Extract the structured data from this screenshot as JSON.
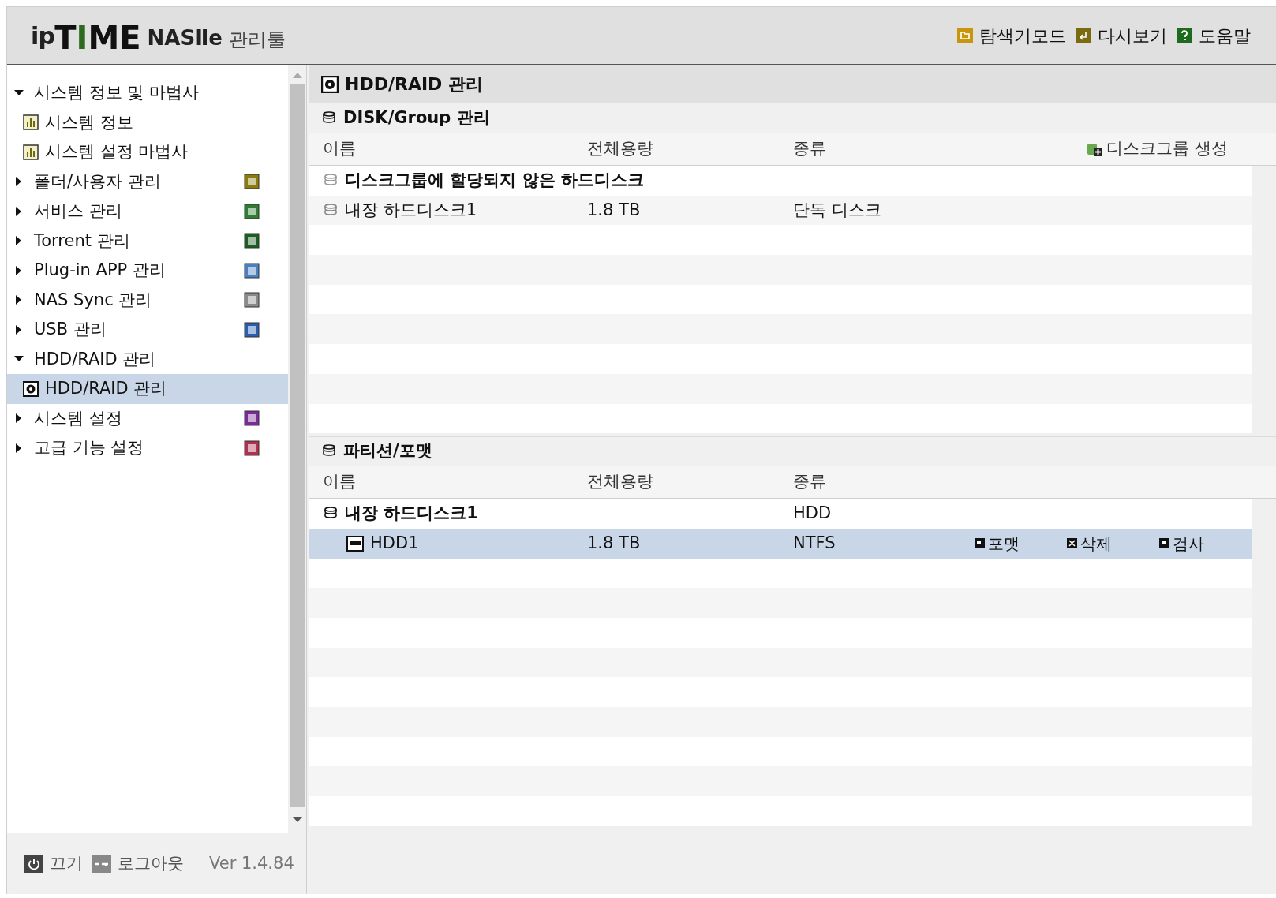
{
  "header": {
    "logo": [
      {
        "kind": "plain",
        "text": "ip"
      },
      {
        "kind": "bold",
        "text": "T"
      },
      {
        "kind": "accent",
        "text": "I"
      },
      {
        "kind": "bold",
        "text": "ME"
      },
      {
        "kind": "product",
        "text": "NASⅡe"
      },
      {
        "kind": "suffix",
        "text": "관리툴"
      }
    ],
    "links": [
      {
        "label": "탐색기모드",
        "color": "#c8960c",
        "kind": "folder"
      },
      {
        "label": "다시보기",
        "color": "#7a6a10",
        "kind": "return"
      },
      {
        "label": "도움말",
        "color": "#1e6a1e",
        "kind": "help"
      }
    ]
  },
  "sidebar": {
    "items": [
      {
        "label": "시스템 정보 및 마법사",
        "expanded": true,
        "children": [
          {
            "label": "시스템 정보",
            "kind": "chart",
            "selected": false
          },
          {
            "label": "시스템 설정 마법사",
            "kind": "chart",
            "selected": false
          }
        ]
      },
      {
        "label": "폴더/사용자 관리",
        "expanded": false,
        "color": "#8a7a10"
      },
      {
        "label": "서비스 관리",
        "expanded": false,
        "color": "#2e7d32"
      },
      {
        "label": "Torrent 관리",
        "expanded": false,
        "color": "#1b5e20"
      },
      {
        "label": "Plug-in APP 관리",
        "expanded": false,
        "color": "#4a7fc1"
      },
      {
        "label": "NAS Sync 관리",
        "expanded": false,
        "color": "#8a8a8a"
      },
      {
        "label": "USB 관리",
        "expanded": false,
        "color": "#2a5fb0"
      },
      {
        "label": "HDD/RAID 관리",
        "expanded": true,
        "children": [
          {
            "label": "HDD/RAID 관리",
            "kind": "disk",
            "selected": true
          }
        ]
      },
      {
        "label": "시스템 설정",
        "expanded": false,
        "color": "#7b2a9a"
      },
      {
        "label": "고급 기능 설정",
        "expanded": false,
        "color": "#b03050"
      }
    ]
  },
  "page": {
    "title": "HDD/RAID 관리",
    "sections": [
      {
        "title": "DISK/Group 관리",
        "columns": [
          "이름",
          "전체용량",
          "종류"
        ],
        "action": "디스크그룹 생성",
        "rows": [
          {
            "kind": "group",
            "name": "디스크그룹에 할당되지 않은 하드디스크",
            "selected": false
          },
          {
            "kind": "disk",
            "name": "내장 하드디스크1",
            "size": "1.8 TB",
            "type": "단독 디스크",
            "selected": false
          }
        ]
      },
      {
        "title": "파티션/포맷",
        "columns": [
          "이름",
          "전체용량",
          "종류"
        ],
        "rows": [
          {
            "kind": "group",
            "name": "내장 하드디스크1",
            "type": "HDD",
            "selected": false
          },
          {
            "kind": "partition",
            "name": "HDD1",
            "size": "1.8 TB",
            "type": "NTFS",
            "selected": true,
            "actions": [
              "포맷",
              "삭제",
              "검사"
            ]
          }
        ]
      }
    ]
  },
  "footer": {
    "buttons": [
      {
        "label": "끄기",
        "kind": "power"
      },
      {
        "label": "로그아웃",
        "kind": "key"
      }
    ],
    "version": "Ver 1.4.84"
  }
}
